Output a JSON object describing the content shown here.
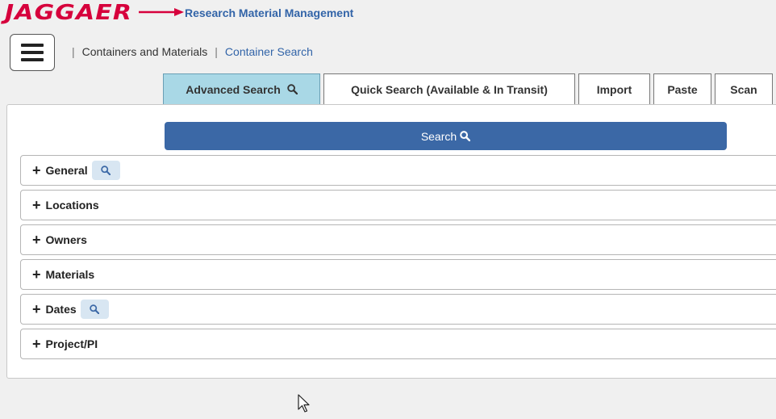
{
  "header": {
    "logo_text": "JAGGAER",
    "app_title": "Research Material Management"
  },
  "breadcrumb": {
    "items": [
      "Containers and Materials",
      "Container Search"
    ],
    "separator": "|"
  },
  "tabs": [
    {
      "label": "Advanced Search",
      "active": true,
      "icon": "search-icon"
    },
    {
      "label": "Quick Search (Available & In Transit)",
      "active": false
    },
    {
      "label": "Import",
      "active": false
    },
    {
      "label": "Paste",
      "active": false
    },
    {
      "label": "Scan",
      "active": false
    }
  ],
  "search_button": {
    "label": "Search",
    "icon": "search-icon"
  },
  "sections": [
    {
      "label": "General",
      "has_search_chip": true
    },
    {
      "label": "Locations",
      "has_search_chip": false
    },
    {
      "label": "Owners",
      "has_search_chip": false
    },
    {
      "label": "Materials",
      "has_search_chip": false
    },
    {
      "label": "Dates",
      "has_search_chip": true
    },
    {
      "label": "Project/PI",
      "has_search_chip": false
    }
  ],
  "colors": {
    "brand_red": "#d6003c",
    "link_blue": "#3264a8",
    "active_tab": "#a9d8e6",
    "search_button": "#3b68a6",
    "search_chip": "#d8e6f2"
  }
}
